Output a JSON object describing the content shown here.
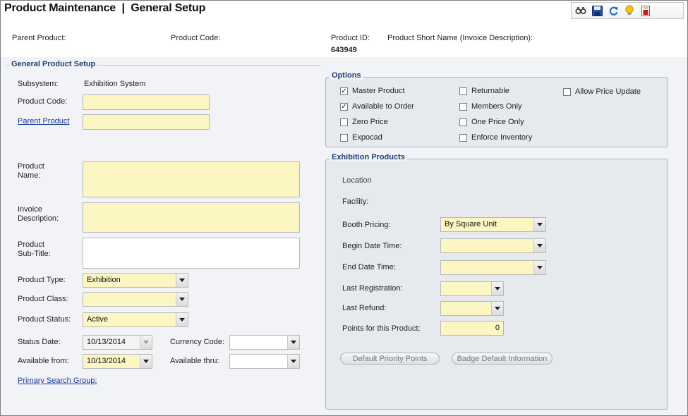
{
  "window": {
    "title": "Product Maintenance  |  General Setup"
  },
  "toolbar": {
    "icons": [
      "search-binoculars-icon",
      "save-icon",
      "refresh-icon",
      "tip-lightbulb-icon",
      "report-icon"
    ]
  },
  "header": {
    "parent_product_label": "Parent Product:",
    "product_code_label": "Product Code:",
    "product_id_label": "Product ID:",
    "product_id_value": "643949",
    "short_name_label": "Product Short Name (Invoice Description):"
  },
  "general": {
    "section_title": "General Product Setup",
    "subsystem_label": "Subsystem:",
    "subsystem_value": "Exhibition System",
    "product_code_label": "Product Code:",
    "product_code_value": "",
    "parent_product_label": "Parent Product",
    "parent_product_value": "",
    "product_name_label": "Product\nName:",
    "product_name_value": "",
    "invoice_desc_label": "Invoice\nDescription:",
    "invoice_desc_value": "",
    "subtitle_label": "Product\nSub-Title:",
    "subtitle_value": "",
    "product_type_label": "Product Type:",
    "product_type_value": "Exhibition",
    "product_class_label": "Product Class:",
    "product_class_value": "",
    "product_status_label": "Product Status:",
    "product_status_value": "Active",
    "status_date_label": "Status Date:",
    "status_date_value": "10/13/2014",
    "currency_code_label": "Currency Code:",
    "currency_code_value": "",
    "available_from_label": "Available from:",
    "available_from_value": "10/13/2014",
    "available_thru_label": "Available thru:",
    "available_thru_value": "",
    "primary_search_group_label": "Primary Search Group:"
  },
  "options": {
    "title": "Options",
    "items": [
      {
        "label": "Master Product",
        "checked": true
      },
      {
        "label": "Available to Order",
        "checked": true
      },
      {
        "label": "Zero Price",
        "checked": false
      },
      {
        "label": "Expocad",
        "checked": false
      },
      {
        "label": "Returnable",
        "checked": false
      },
      {
        "label": "Members Only",
        "checked": false
      },
      {
        "label": "One Price Only",
        "checked": false
      },
      {
        "label": "Enforce Inventory",
        "checked": false
      },
      {
        "label": "Allow Price Update",
        "checked": false
      }
    ]
  },
  "exhibition": {
    "title": "Exhibition Products",
    "location_label": "Location",
    "facility_label": "Facility:",
    "booth_pricing_label": "Booth Pricing:",
    "booth_pricing_value": "By Square Unit",
    "begin_date_label": "Begin Date Time:",
    "begin_date_value": "",
    "end_date_label": "End Date Time:",
    "end_date_value": "",
    "last_registration_label": "Last Registration:",
    "last_registration_value": "",
    "last_refund_label": "Last Refund:",
    "last_refund_value": "",
    "points_label": "Points for this Product:",
    "points_value": "0",
    "default_priority_button": "Default Priority Points",
    "badge_default_button": "Badge Default Information"
  }
}
